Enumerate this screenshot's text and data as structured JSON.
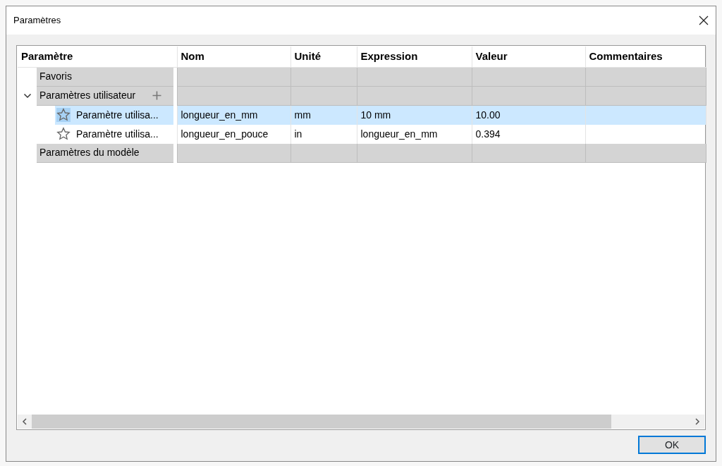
{
  "window": {
    "title": "Paramètres"
  },
  "table": {
    "columns": [
      "Paramètre",
      "Nom",
      "Unité",
      "Expression",
      "Valeur",
      "Commentaires"
    ],
    "rows": [
      {
        "kind": "group",
        "label": "Favoris",
        "expanded": false,
        "addable": false
      },
      {
        "kind": "group",
        "label": "Paramètres utilisateur",
        "expanded": true,
        "addable": true,
        "children": [
          {
            "parameter": "Paramètre utilisa...",
            "name": "longueur_en_mm",
            "unit": "mm",
            "expression": "10 mm",
            "value": "10.00",
            "selected": true
          },
          {
            "parameter": "Paramètre utilisa...",
            "name": "longueur_en_pouce",
            "unit": "in",
            "expression": "longueur_en_mm",
            "value": "0.394",
            "selected": false
          }
        ]
      },
      {
        "kind": "group",
        "label": "Paramètres du modèle",
        "expanded": false,
        "addable": false
      }
    ]
  },
  "buttons": [
    "OK"
  ]
}
